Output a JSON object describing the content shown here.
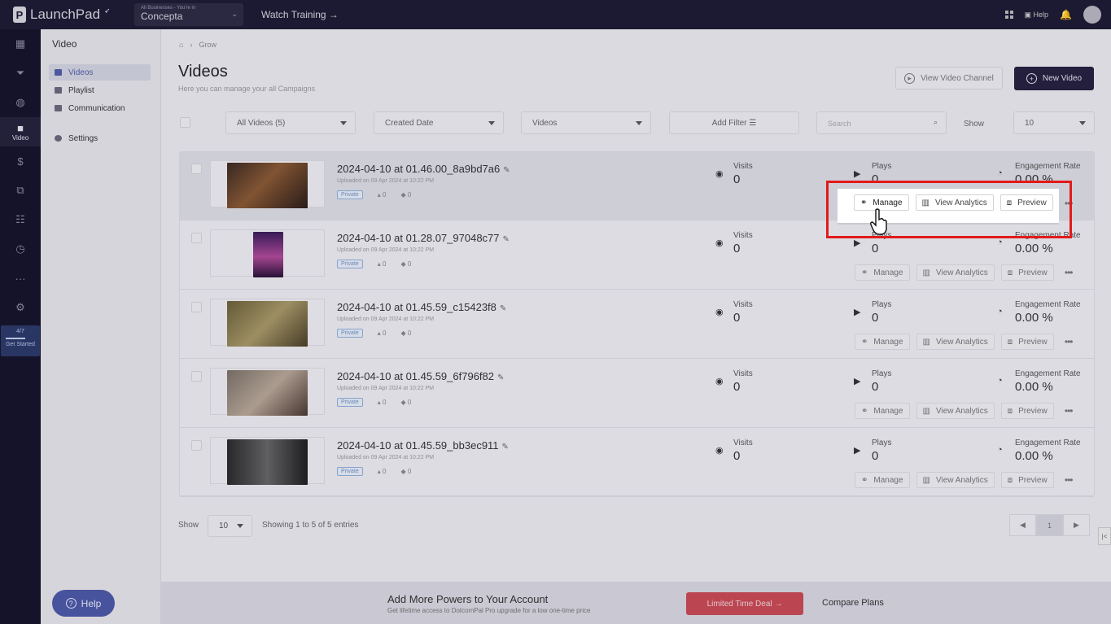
{
  "topbar": {
    "logo": "LaunchPad",
    "business_label": "All Businesses - You're in",
    "business_name": "Concepta",
    "watch_training": "Watch Training →",
    "help": "Help"
  },
  "rail": {
    "active_label": "Video",
    "progress": "4/7",
    "get_started": "Get Started"
  },
  "subnav": {
    "heading": "Video",
    "items": [
      {
        "label": "Videos"
      },
      {
        "label": "Playlist"
      },
      {
        "label": "Communication"
      },
      {
        "label": "Settings"
      }
    ],
    "help_button": "Help"
  },
  "page": {
    "breadcrumb": "Grow",
    "title": "Videos",
    "subtitle": "Here you can manage your all Campaigns",
    "view_channel": "View Video Channel",
    "new_video": "New Video"
  },
  "filters": {
    "all_videos": "All Videos (5)",
    "created_date": "Created Date",
    "videos": "Videos",
    "add_filter": "Add Filter",
    "search_placeholder": "Search",
    "show_label": "Show",
    "show_value": "10"
  },
  "labels": {
    "visits": "Visits",
    "plays": "Plays",
    "engagement": "Engagement Rate",
    "private": "Private",
    "manage": "Manage",
    "view_analytics": "View Analytics",
    "preview": "Preview"
  },
  "videos": [
    {
      "title": "2024-04-10 at 01.46.00_8a9bd7a6",
      "uploaded": "Uploaded on 09 Apr 2024 at 10:22 PM",
      "likes": "0",
      "comments": "0",
      "visits": "0",
      "plays": "0",
      "engagement": "0.00 %"
    },
    {
      "title": "2024-04-10 at 01.28.07_97048c77",
      "uploaded": "Uploaded on 09 Apr 2024 at 10:22 PM",
      "likes": "0",
      "comments": "0",
      "visits": "0",
      "plays": "0",
      "engagement": "0.00 %"
    },
    {
      "title": "2024-04-10 at 01.45.59_c15423f8",
      "uploaded": "Uploaded on 09 Apr 2024 at 10:22 PM",
      "likes": "0",
      "comments": "0",
      "visits": "0",
      "plays": "0",
      "engagement": "0.00 %"
    },
    {
      "title": "2024-04-10 at 01.45.59_6f796f82",
      "uploaded": "Uploaded on 09 Apr 2024 at 10:22 PM",
      "likes": "0",
      "comments": "0",
      "visits": "0",
      "plays": "0",
      "engagement": "0.00 %"
    },
    {
      "title": "2024-04-10 at 01.45.59_bb3ec911",
      "uploaded": "Uploaded on 09 Apr 2024 at 10:22 PM",
      "likes": "0",
      "comments": "0",
      "visits": "0",
      "plays": "0",
      "engagement": "0.00 %"
    }
  ],
  "footer": {
    "show_label": "Show",
    "show_value": "10",
    "entries": "Showing 1 to 5 of 5 entries",
    "page": "1"
  },
  "banner": {
    "title": "Add More Powers to Your Account",
    "subtitle": "Get lifetime access to DotcomPal Pro upgrade for a low one-time price",
    "deal": "Limited Time Deal →",
    "compare": "Compare Plans"
  },
  "colors": {
    "accent": "#24213f",
    "highlight_box": "#e21b1b",
    "deal": "#c94b55"
  }
}
